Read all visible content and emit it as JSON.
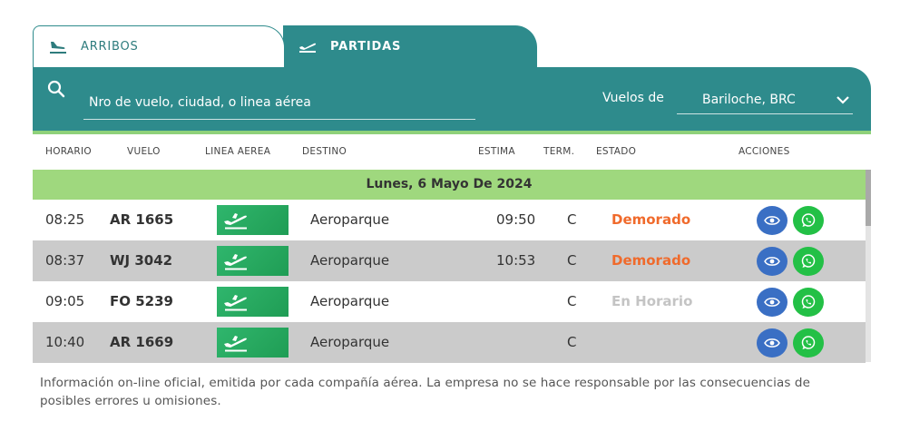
{
  "tabs": {
    "arribos": {
      "label": "ARRIBOS",
      "icon": "plane-landing-icon"
    },
    "partidas": {
      "label": "PARTIDAS",
      "icon": "plane-takeoff-icon",
      "active": true
    }
  },
  "search": {
    "placeholder": "Nro de vuelo, ciudad, o linea aérea",
    "icon": "search-icon"
  },
  "airport": {
    "label": "Vuelos de",
    "value": "Bariloche, BRC"
  },
  "columns": {
    "horario": "HORARIO",
    "vuelo": "VUELO",
    "linea": "LINEA AEREA",
    "destino": "DESTINO",
    "estima": "ESTIMA",
    "term": "TERM.",
    "estado": "ESTADO",
    "acciones": "ACCIONES"
  },
  "date_label": "Lunes, 6 Mayo De 2024",
  "flights": [
    {
      "time": "08:25",
      "flight": "AR 1665",
      "destination": "Aeroparque",
      "estimated": "09:50",
      "terminal": "C",
      "status": "Demorado",
      "status_color": "#f06a2b"
    },
    {
      "time": "08:37",
      "flight": "WJ 3042",
      "destination": "Aeroparque",
      "estimated": "10:53",
      "terminal": "C",
      "status": "Demorado",
      "status_color": "#f06a2b"
    },
    {
      "time": "09:05",
      "flight": "FO 5239",
      "destination": "Aeroparque",
      "estimated": "",
      "terminal": "C",
      "status": "En Horario",
      "status_color": "#c4c4c4"
    },
    {
      "time": "10:40",
      "flight": "AR 1669",
      "destination": "Aeroparque",
      "estimated": "",
      "terminal": "C",
      "status": "",
      "status_color": ""
    }
  ],
  "colors": {
    "teal": "#2e8b8c",
    "green_bar": "#9fd87e",
    "eye_button": "#3a6fc4",
    "whatsapp_button": "#23c046"
  },
  "footer": {
    "text": "Información on-line oficial, emitida por cada compañía aérea. La empresa no se hace responsable por las consecuencias de posibles errores u omisiones."
  }
}
